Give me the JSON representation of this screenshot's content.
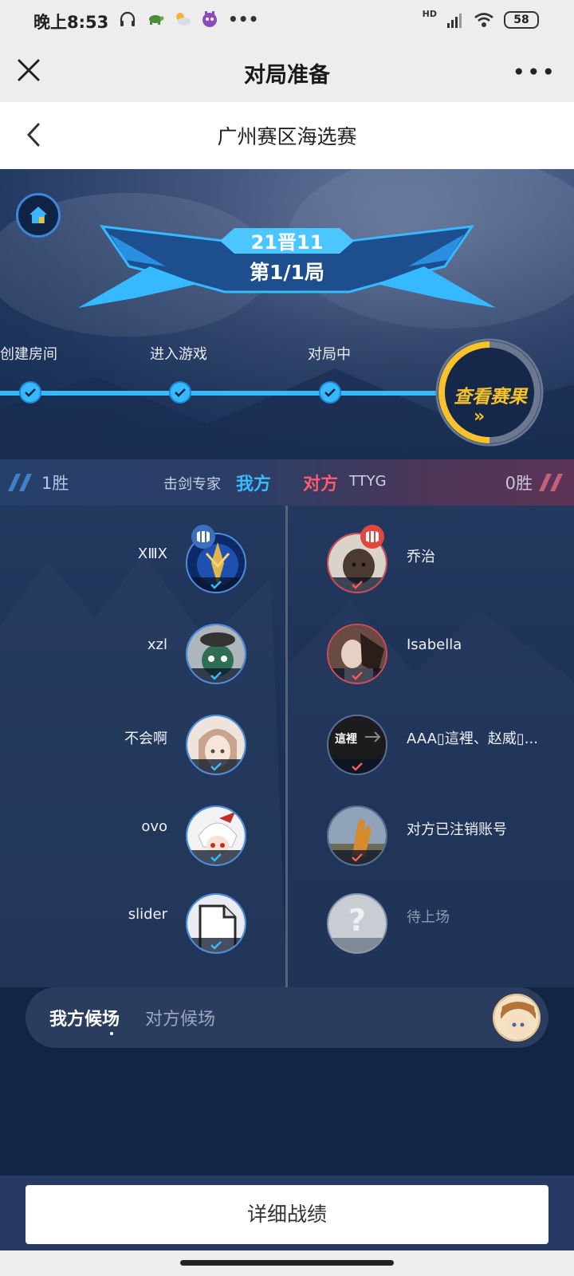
{
  "status_bar": {
    "time": "晚上8:53",
    "network": "HD",
    "battery": "58"
  },
  "wechat_bar": {
    "title": "对局准备",
    "more": "•••"
  },
  "header": {
    "title": "广州赛区海选赛"
  },
  "match": {
    "score": "21晋11",
    "round": "第1/1局"
  },
  "steps": [
    {
      "label": "创建房间"
    },
    {
      "label": "进入游戏"
    },
    {
      "label": "对局中"
    }
  ],
  "result_button": {
    "label": "查看赛果",
    "arrow": "»"
  },
  "teams": {
    "left": {
      "wins": "1胜",
      "name": "击剑专家",
      "tag": "我方"
    },
    "right": {
      "wins": "0胜",
      "name": "TTYG",
      "tag": "对方"
    }
  },
  "players_left": [
    {
      "name": "XⅢX"
    },
    {
      "name": "xzl"
    },
    {
      "name": "不会啊"
    },
    {
      "name": "ovo"
    },
    {
      "name": "slider"
    }
  ],
  "players_right": [
    {
      "name": "乔治"
    },
    {
      "name": "Isabella"
    },
    {
      "name": "AAA▯這裡、赵威▯..."
    },
    {
      "name": "对方已注销账号"
    },
    {
      "name": "待上场"
    }
  ],
  "avatar_text": {
    "zheli": "這裡",
    "unknown": "?"
  },
  "bench": {
    "mine": "我方候场",
    "opponent": "对方候场"
  },
  "bottom": {
    "detail_button": "详细战绩"
  },
  "colors": {
    "accent_blue": "#36b9ff",
    "accent_red": "#ff5a6e",
    "gold": "#f7c22b"
  }
}
